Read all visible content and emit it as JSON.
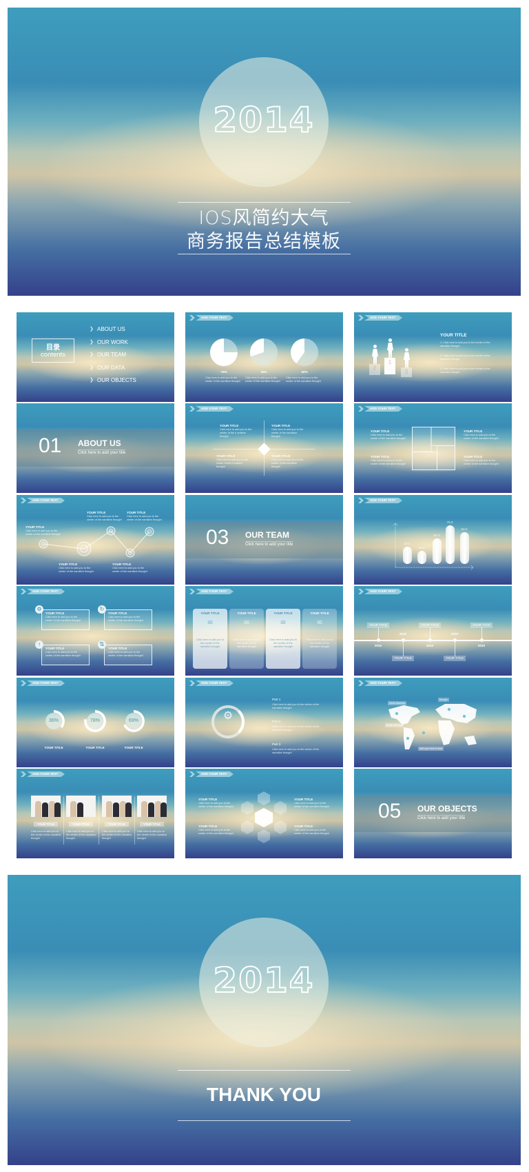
{
  "colors": {
    "sky_top": "#3e9dbd",
    "warm_center": "#f6e8c4",
    "navy_bottom": "#34418a",
    "text": "#ffffff"
  },
  "cover": {
    "year": "2014",
    "title_line1": "IOS风简约大气",
    "title_line2": "商务报告总结模板"
  },
  "slides": {
    "contents": {
      "title_cn": "目录",
      "title_en": "contents",
      "items": [
        "ABOUT US",
        "OUR WORK",
        "OUR TEAM",
        "OUR DATA",
        "OUR OBJECTS"
      ]
    },
    "pies": {
      "header": "ADD YOUR TEXT",
      "items": [
        {
          "label": "75%",
          "value": 75,
          "text": "Click here to add you to the center of the narrative thought"
        },
        {
          "label": "30%",
          "value": 30,
          "text": "Click here to add you to the center of the narrative thought"
        },
        {
          "label": "40%",
          "value": 40,
          "text": "Click here to add you to the center of the narrative thought"
        }
      ]
    },
    "podium": {
      "header": "ADD YOUR TEXT",
      "title": "YOUR TITLE",
      "places": [
        "2",
        "1",
        "3"
      ],
      "items": [
        "1. Click here to add you to the center of the narrative thought",
        "2. Click here to add you to the center of the narrative thought",
        "3. Click here to add you to the center of the narrative thought"
      ]
    },
    "section1": {
      "number": "01",
      "title": "ABOUT  US",
      "subtitle": "Click here to add your title"
    },
    "diamond": {
      "header": "ADD YOUR TEXT",
      "blocks": [
        {
          "title": "YOUR TITLE",
          "text": "Click here to add you to the center of the n arrative thought"
        },
        {
          "title": "YOUR TITLE",
          "text": "Click here to add you to the center of the narrative thought"
        },
        {
          "title": "YOUR TITLE",
          "text": "Click here to add you to the center of the n arrative thought"
        },
        {
          "title": "YOUR TITLE",
          "text": "Click here to add you to the center of the narrative thought"
        }
      ]
    },
    "squares": {
      "header": "ADD YOUR TEXT",
      "blocks": [
        {
          "title": "YOUR TITLE",
          "text": "Click here to add you to the center of the narrative thought"
        },
        {
          "title": "YOUR TITLE",
          "text": "Click here to add you to the center of the narrative thought"
        },
        {
          "title": "YOUR TITLE",
          "text": "Click here to add you to the center of the narrative thought"
        },
        {
          "title": "YOUR TITLE",
          "text": "Click here to add you to the center of the narrative thought"
        }
      ]
    },
    "linechart": {
      "header": "ADD YOUR TEXT",
      "blocks": [
        {
          "title": "YOUR TITLE",
          "text": "Click here to add you to the center of the narrative thought"
        },
        {
          "title": "YOUR TITLE",
          "text": "Click here to add you to the center of the narrative thought"
        },
        {
          "title": "YOUR TITLE",
          "text": "Click here to add you to the center of the narrative thought"
        },
        {
          "title": "YOUR TITLE",
          "text": "Click here to add you to the center of the narrative thought"
        },
        {
          "title": "YOUR TITLE",
          "text": "Click here to add you to the center of the narrative thought"
        }
      ]
    },
    "section3": {
      "number": "03",
      "title": "OUR TEAM",
      "subtitle": "Click here to add your title"
    },
    "bars": {
      "header": "ADD YOUR TEXT",
      "labels": [
        "33.0",
        "25.0",
        "50.0",
        "75.0",
        "62.0"
      ]
    },
    "iconboxes": {
      "header": "ADD YOUR TEXT",
      "blocks": [
        {
          "title": "YOUR TITLE",
          "text": "Click here to add you to the center of the narrative thought",
          "icon": "gears-icon"
        },
        {
          "title": "YOUR TITLE",
          "text": "Click here to add you to the center of the narrative thought",
          "icon": "refresh-icon"
        },
        {
          "title": "YOUR TITLE",
          "text": "Click here to add you to the center of the narrative thought",
          "icon": "arrow-up-icon"
        },
        {
          "title": "YOUR TITLE",
          "text": "Click here to add you to the center of the narrative thought",
          "icon": "sync-icon"
        }
      ]
    },
    "cards": {
      "header": "ADD YOUR TEXT",
      "blocks": [
        {
          "title": "YOUR TITLE",
          "text": "Click here to add you to the center of the narrative thought"
        },
        {
          "title": "YOUR TITLE",
          "text": "Click here to add you to the center of the narrative thought"
        },
        {
          "title": "YOUR TITLE",
          "text": "Click here to add you to the center of the narrative thought"
        },
        {
          "title": "YOUR TITLE",
          "text": "Click here to add you to the center of the narrative thought"
        }
      ]
    },
    "timeline": {
      "header": "ADD YOUR TEXT",
      "points": [
        {
          "title": "YOUR TITLE",
          "year": "2010"
        },
        {
          "title": "YOUR TITLE",
          "year": "2010"
        },
        {
          "title": "YOUR TITLE",
          "year": "2010"
        },
        {
          "title": "YOUR TITLE",
          "year": "2010"
        },
        {
          "title": "YOUR TITLE",
          "year": "2010"
        }
      ]
    },
    "donuts": {
      "header": "ADD YOUR TEXT",
      "items": [
        {
          "label": "36%",
          "value": 36,
          "title": "YOUR TITLE"
        },
        {
          "label": "78%",
          "value": 78,
          "title": "YOUR TITLE"
        },
        {
          "label": "69%",
          "value": 69,
          "title": "YOUR TITLE"
        }
      ]
    },
    "parts": {
      "header": "ADD YOUR TEXT",
      "items": [
        {
          "title": "Part 1",
          "text": "Click here to add you to the center of the narrative thought"
        },
        {
          "title": "Part 2",
          "text": "Click here to add you to the center of the narrative thought"
        },
        {
          "title": "Part 3",
          "text": "Click here to add you to the center of the narrative thought"
        }
      ]
    },
    "map": {
      "header": "ADD YOUR TEXT",
      "labels": [
        "North America",
        "Europe",
        "Asia",
        "South America",
        "Add your text in here"
      ]
    },
    "photos": {
      "header": "ADD YOUR TEXT",
      "blocks": [
        {
          "title": "YOUR TITLE",
          "text": "Click here to add you to the center of the narrative thought"
        },
        {
          "title": "YOUR TITLE",
          "text": "Click here to add you to the center of the narrative thought"
        },
        {
          "title": "YOUR TITLE",
          "text": "Click here to add you to the center of the narrative thought"
        },
        {
          "title": "YOUR TITLE",
          "text": "Click here to add you to the center of the narrative thought"
        }
      ]
    },
    "hexagons": {
      "header": "ADD YOUR TEXT",
      "blocks": [
        {
          "title": "YOUR TITLE",
          "text": "Click here to add you to the center of the narrative thought"
        },
        {
          "title": "YOUR TITLE",
          "text": "Click here to add you to the center of the narrative thought"
        },
        {
          "title": "YOUR TITLE",
          "text": "Click here to add you to the center of the narrative thought"
        },
        {
          "title": "YOUR TITLE",
          "text": "Click here to add you to the center of the narrative thought"
        }
      ]
    },
    "section5": {
      "number": "05",
      "title": "OUR OBJECTS",
      "subtitle": "Click here to add your title"
    }
  },
  "ending": {
    "year": "2014",
    "message": "THANK YOU"
  }
}
